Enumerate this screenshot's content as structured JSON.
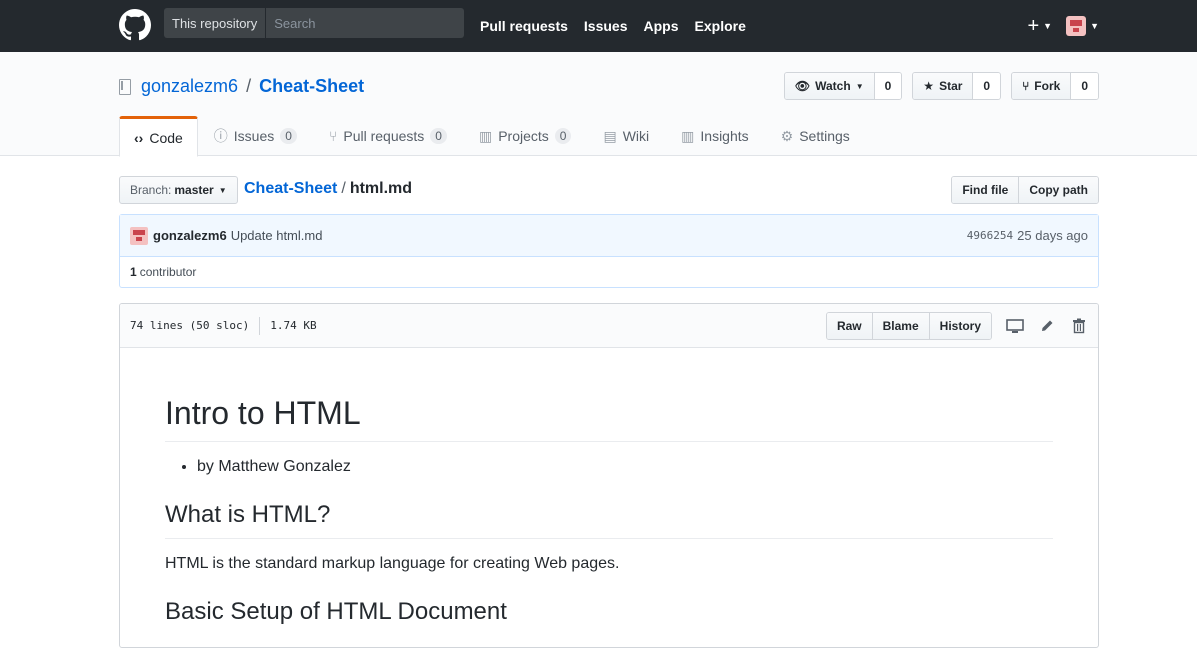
{
  "header": {
    "search_scope": "This repository",
    "search_placeholder": "Search",
    "nav": [
      "Pull requests",
      "Issues",
      "Apps",
      "Explore"
    ],
    "plus_label": "+"
  },
  "repo": {
    "owner": "gonzalezm6",
    "separator": "/",
    "name": "Cheat-Sheet",
    "watch": {
      "label": "Watch",
      "count": "0"
    },
    "star": {
      "label": "Star",
      "count": "0"
    },
    "fork": {
      "label": "Fork",
      "count": "0"
    },
    "tabs": [
      {
        "label": "Code",
        "icon": "code-icon",
        "glyph": "‹›"
      },
      {
        "label": "Issues",
        "count": "0",
        "icon": "issue-icon",
        "glyph": "ⓘ"
      },
      {
        "label": "Pull requests",
        "count": "0",
        "icon": "pull-request-icon",
        "glyph": "⑂"
      },
      {
        "label": "Projects",
        "count": "0",
        "icon": "project-icon",
        "glyph": "▥"
      },
      {
        "label": "Wiki",
        "icon": "book-icon",
        "glyph": "▤"
      },
      {
        "label": "Insights",
        "icon": "graph-icon",
        "glyph": "▥"
      },
      {
        "label": "Settings",
        "icon": "gear-icon",
        "glyph": "⚙"
      }
    ]
  },
  "filenav": {
    "branch_label": "Branch:",
    "branch_value": "master",
    "bc_repo": "Cheat-Sheet",
    "bc_sep": "/",
    "bc_file": "html.md",
    "find_file": "Find file",
    "copy_path": "Copy path"
  },
  "commit": {
    "author": "gonzalezm6",
    "message": "Update html.md",
    "sha": "4966254",
    "time": "25 days ago",
    "contrib_count": "1",
    "contrib_label": "contributor"
  },
  "file": {
    "lines": "74 lines (50 sloc)",
    "size": "1.74 KB",
    "raw": "Raw",
    "blame": "Blame",
    "history": "History",
    "icons": [
      "desktop-icon",
      "pencil-icon",
      "trash-icon"
    ]
  },
  "content": {
    "h1": "Intro to HTML",
    "bullet": "by Matthew Gonzalez",
    "h2_1": "What is HTML?",
    "p1": "HTML is the standard markup language for creating Web pages.",
    "h2_2": "Basic Setup of HTML Document"
  }
}
